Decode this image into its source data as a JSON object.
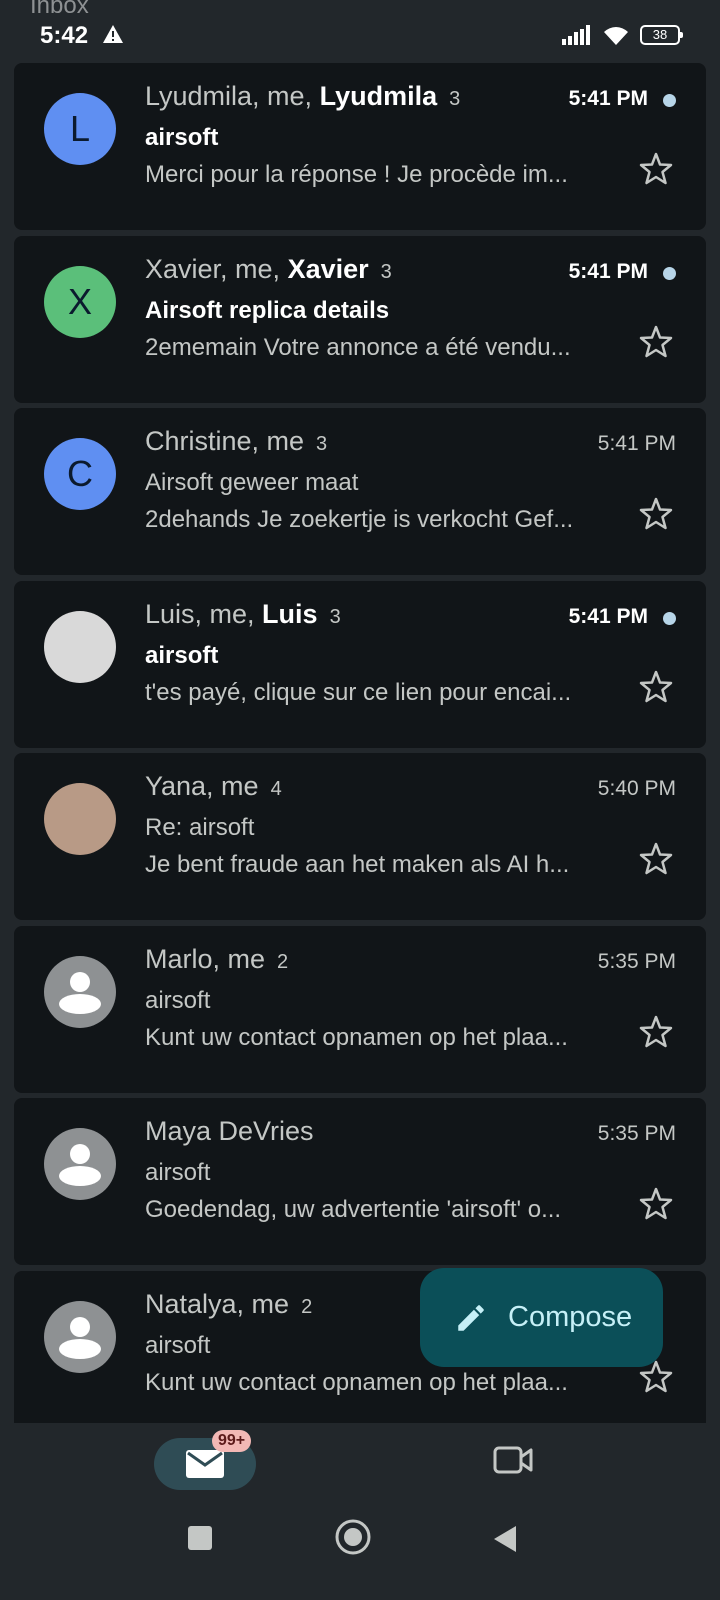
{
  "status": {
    "inbox_label": "Inbox",
    "time": "5:42",
    "battery": "38"
  },
  "emails": [
    {
      "avatar_letter": "L",
      "avatar_color": "#5f8ff2",
      "sender_plain": "Lyudmila, me, ",
      "sender_bold": "Lyudmila",
      "count": "3",
      "time": "5:41 PM",
      "unread": true,
      "subject": "airsoft",
      "snippet": "Merci pour la réponse ! Je procède im..."
    },
    {
      "avatar_letter": "X",
      "avatar_color": "#5bbf7a",
      "sender_plain": "Xavier, me, ",
      "sender_bold": "Xavier",
      "count": "3",
      "time": "5:41 PM",
      "unread": true,
      "subject": "Airsoft replica details",
      "snippet": "2ememain Votre annonce a été vendu..."
    },
    {
      "avatar_letter": "C",
      "avatar_color": "#5f8ff2",
      "sender_plain": "Christine, me",
      "sender_bold": "",
      "count": "3",
      "time": "5:41 PM",
      "unread": false,
      "subject": "Airsoft geweer maat",
      "snippet": "2dehands Je zoekertje is verkocht Gef..."
    },
    {
      "avatar_letter": "",
      "avatar_color": "#d9d9d9",
      "sender_plain": "Luis, me, ",
      "sender_bold": "Luis",
      "count": "3",
      "time": "5:41 PM",
      "unread": true,
      "subject": "airsoft",
      "snippet": "t'es payé, clique sur ce lien pour encai..."
    },
    {
      "avatar_letter": "",
      "avatar_color": "#b89a86",
      "sender_plain": "Yana, me",
      "sender_bold": "",
      "count": "4",
      "time": "5:40 PM",
      "unread": false,
      "subject": "Re: airsoft",
      "snippet": "Je bent fraude aan het maken als AI h..."
    },
    {
      "avatar_letter": "",
      "avatar_color": "#8e9193",
      "sender_plain": "Marlo, me",
      "sender_bold": "",
      "count": "2",
      "time": "5:35 PM",
      "unread": false,
      "subject": "airsoft",
      "snippet": "Kunt uw contact opnamen op het plaa..."
    },
    {
      "avatar_letter": "",
      "avatar_color": "#8e9193",
      "sender_plain": "Maya DeVries",
      "sender_bold": "",
      "count": "",
      "time": "5:35 PM",
      "unread": false,
      "subject": "airsoft",
      "snippet": "Goedendag, uw advertentie 'airsoft' o..."
    },
    {
      "avatar_letter": "",
      "avatar_color": "#8e9193",
      "sender_plain": "Natalya, me",
      "sender_bold": "",
      "count": "2",
      "time": "",
      "unread": false,
      "subject": "airsoft",
      "snippet": "Kunt uw contact opnamen op het plaa..."
    }
  ],
  "compose": {
    "label": "Compose"
  },
  "nav": {
    "mail_badge": "99+"
  }
}
